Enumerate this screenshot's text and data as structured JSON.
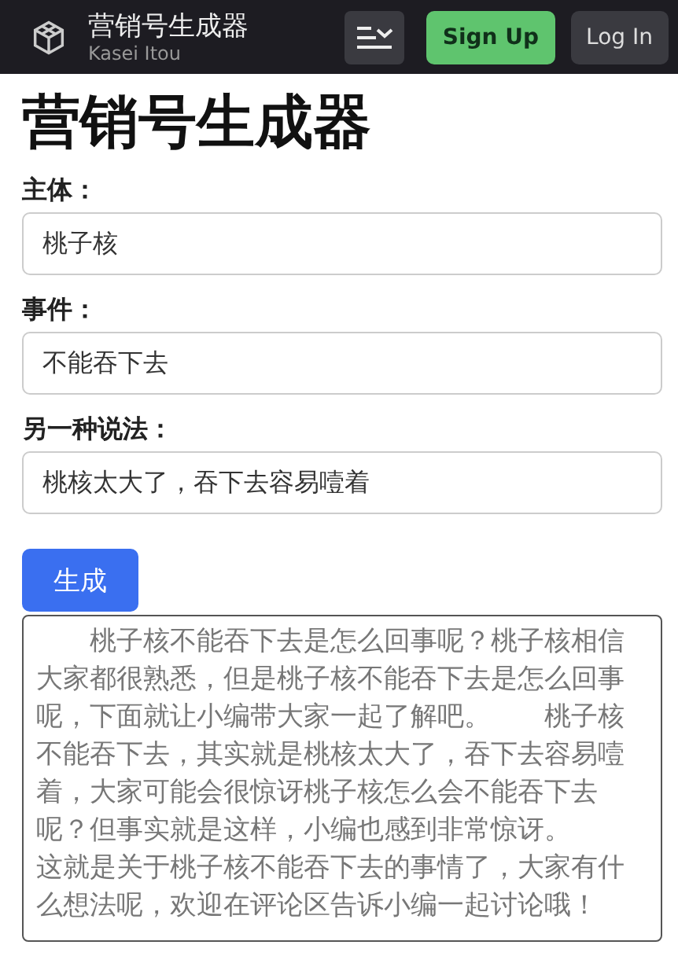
{
  "header": {
    "title": "营销号生成器",
    "subtitle": "Kasei Itou",
    "buttons": [
      {
        "label": "Sign Up",
        "kind": "primary"
      },
      {
        "label": "Log In",
        "kind": "secondary"
      }
    ]
  },
  "heading": "营销号生成器",
  "fields": [
    {
      "label": "主体：",
      "value": "桃子核"
    },
    {
      "label": "事件：",
      "value": "不能吞下去"
    },
    {
      "label": "另一种说法：",
      "value": "桃核太大了，吞下去容易噎着"
    }
  ],
  "generate_button": "生成",
  "output": [
    "　　桃子核不能吞下去是怎么回事呢？桃子核相信大家都很熟悉，但是桃子核不能吞下去是怎么回事呢，下面就让小编带大家一起了解吧。　　桃子核不能吞下去，其实就是桃核太大了，吞下去容易噎着，大家可能会很惊讶桃子核怎么会不能吞下去呢？但事实就是这样，小编也感到非常惊讶。",
    "这就是关于桃子核不能吞下去的事情了，大家有什么想法呢，欢迎在评论区告诉小编一起讨论哦！"
  ]
}
